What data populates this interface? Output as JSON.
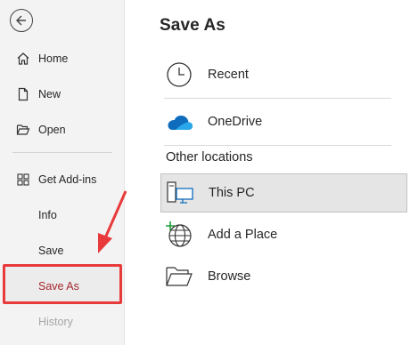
{
  "sidebar": {
    "back_icon": "arrow-left-circle-icon",
    "items": [
      {
        "label": "Home",
        "icon": "home-icon"
      },
      {
        "label": "New",
        "icon": "new-document-icon"
      },
      {
        "label": "Open",
        "icon": "folder-open-icon"
      },
      {
        "label": "Get Add-ins",
        "icon": "grid-apps-icon"
      },
      {
        "label": "Info"
      },
      {
        "label": "Save"
      },
      {
        "label": "Save As",
        "active": true
      },
      {
        "label": "History",
        "disabled": true
      }
    ]
  },
  "main": {
    "title": "Save As",
    "locations": [
      {
        "label": "Recent",
        "icon": "clock-icon"
      },
      {
        "label": "OneDrive",
        "icon": "onedrive-cloud-icon"
      }
    ],
    "other_header": "Other locations",
    "other_locations": [
      {
        "label": "This PC",
        "icon": "computer-icon",
        "selected": true
      },
      {
        "label": "Add a Place",
        "icon": "globe-add-icon"
      },
      {
        "label": "Browse",
        "icon": "folder-icon"
      }
    ]
  },
  "colors": {
    "active_text": "#a4262c",
    "highlight_border": "#e83a3a",
    "onedrive_blue": "#0f6cbd"
  }
}
